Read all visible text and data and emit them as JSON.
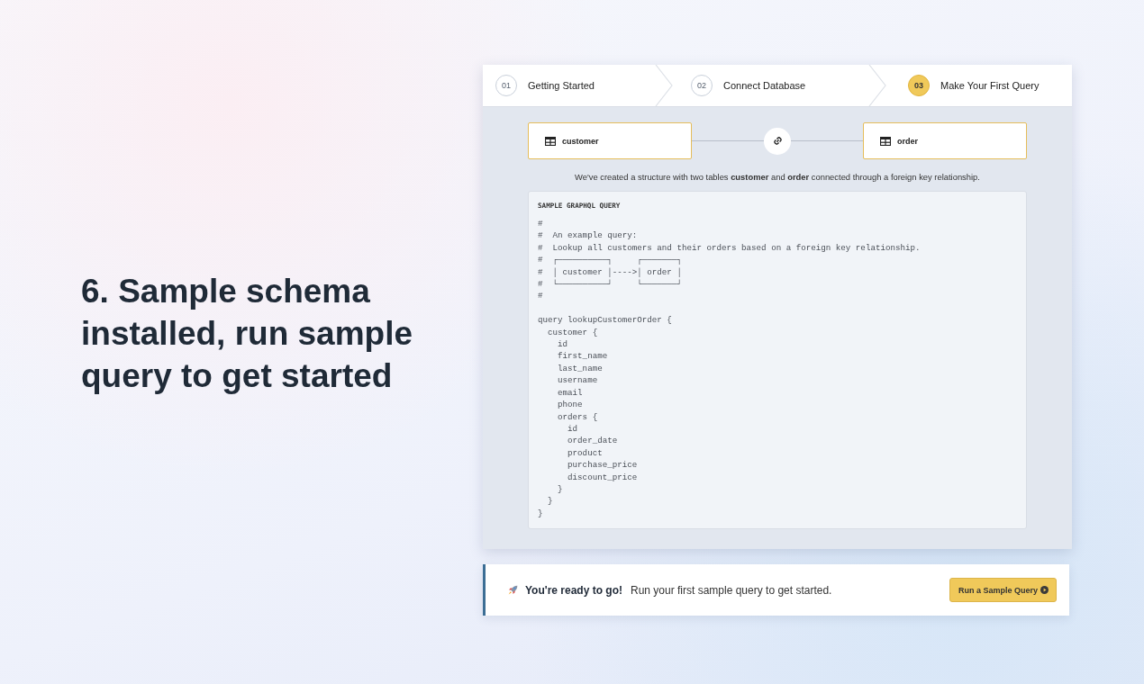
{
  "headline": "6. Sample schema installed, run sample query to get started",
  "steps": [
    {
      "number": "01",
      "label": "Getting Started",
      "selected": false
    },
    {
      "number": "02",
      "label": "Connect Database",
      "selected": false
    },
    {
      "number": "03",
      "label": "Make Your First Query",
      "selected": true
    }
  ],
  "schema": {
    "tables": [
      "customer",
      "order"
    ],
    "description": "We've created a structure with two tables **customer** and **order** connected through a foreign key relationship."
  },
  "query_panel": {
    "title": "SAMPLE GRAPHQL QUERY",
    "code": "#\n#  An example query:\n#  Lookup all customers and their orders based on a foreign key relationship.\n#  ┌──────────┐     ┌───────┐\n#  │ customer │---->│ order │\n#  └──────────┘     └───────┘\n#\n\nquery lookupCustomerOrder {\n  customer {\n    id\n    first_name\n    last_name\n    username\n    email\n    phone\n    orders {\n      id\n      order_date\n      product\n      purchase_price\n      discount_price\n    }\n  }\n}"
  },
  "banner": {
    "title": "You're ready to go!",
    "message": "Run your first sample query to get started.",
    "button": "Run a Sample Query"
  }
}
